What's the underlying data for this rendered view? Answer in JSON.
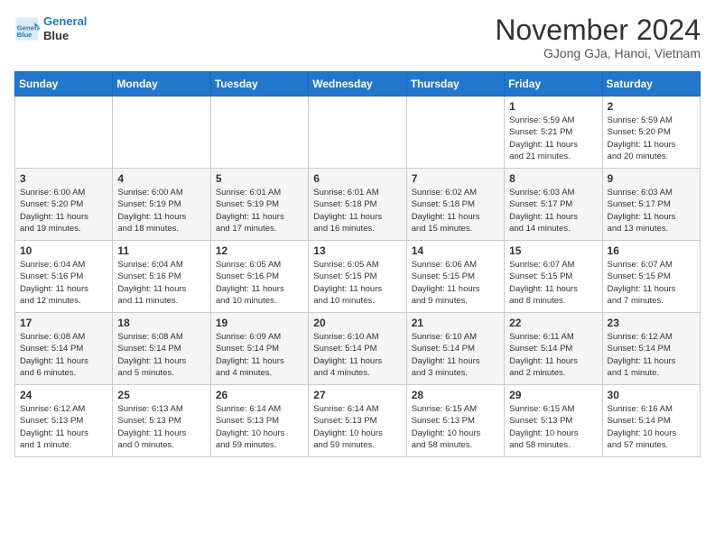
{
  "header": {
    "logo_line1": "General",
    "logo_line2": "Blue",
    "month": "November 2024",
    "location": "GJong GJa, Hanoi, Vietnam"
  },
  "days_of_week": [
    "Sunday",
    "Monday",
    "Tuesday",
    "Wednesday",
    "Thursday",
    "Friday",
    "Saturday"
  ],
  "weeks": [
    [
      {
        "day": "",
        "info": ""
      },
      {
        "day": "",
        "info": ""
      },
      {
        "day": "",
        "info": ""
      },
      {
        "day": "",
        "info": ""
      },
      {
        "day": "",
        "info": ""
      },
      {
        "day": "1",
        "info": "Sunrise: 5:59 AM\nSunset: 5:21 PM\nDaylight: 11 hours\nand 21 minutes."
      },
      {
        "day": "2",
        "info": "Sunrise: 5:59 AM\nSunset: 5:20 PM\nDaylight: 11 hours\nand 20 minutes."
      }
    ],
    [
      {
        "day": "3",
        "info": "Sunrise: 6:00 AM\nSunset: 5:20 PM\nDaylight: 11 hours\nand 19 minutes."
      },
      {
        "day": "4",
        "info": "Sunrise: 6:00 AM\nSunset: 5:19 PM\nDaylight: 11 hours\nand 18 minutes."
      },
      {
        "day": "5",
        "info": "Sunrise: 6:01 AM\nSunset: 5:19 PM\nDaylight: 11 hours\nand 17 minutes."
      },
      {
        "day": "6",
        "info": "Sunrise: 6:01 AM\nSunset: 5:18 PM\nDaylight: 11 hours\nand 16 minutes."
      },
      {
        "day": "7",
        "info": "Sunrise: 6:02 AM\nSunset: 5:18 PM\nDaylight: 11 hours\nand 15 minutes."
      },
      {
        "day": "8",
        "info": "Sunrise: 6:03 AM\nSunset: 5:17 PM\nDaylight: 11 hours\nand 14 minutes."
      },
      {
        "day": "9",
        "info": "Sunrise: 6:03 AM\nSunset: 5:17 PM\nDaylight: 11 hours\nand 13 minutes."
      }
    ],
    [
      {
        "day": "10",
        "info": "Sunrise: 6:04 AM\nSunset: 5:16 PM\nDaylight: 11 hours\nand 12 minutes."
      },
      {
        "day": "11",
        "info": "Sunrise: 6:04 AM\nSunset: 5:16 PM\nDaylight: 11 hours\nand 11 minutes."
      },
      {
        "day": "12",
        "info": "Sunrise: 6:05 AM\nSunset: 5:16 PM\nDaylight: 11 hours\nand 10 minutes."
      },
      {
        "day": "13",
        "info": "Sunrise: 6:05 AM\nSunset: 5:15 PM\nDaylight: 11 hours\nand 10 minutes."
      },
      {
        "day": "14",
        "info": "Sunrise: 6:06 AM\nSunset: 5:15 PM\nDaylight: 11 hours\nand 9 minutes."
      },
      {
        "day": "15",
        "info": "Sunrise: 6:07 AM\nSunset: 5:15 PM\nDaylight: 11 hours\nand 8 minutes."
      },
      {
        "day": "16",
        "info": "Sunrise: 6:07 AM\nSunset: 5:15 PM\nDaylight: 11 hours\nand 7 minutes."
      }
    ],
    [
      {
        "day": "17",
        "info": "Sunrise: 6:08 AM\nSunset: 5:14 PM\nDaylight: 11 hours\nand 6 minutes."
      },
      {
        "day": "18",
        "info": "Sunrise: 6:08 AM\nSunset: 5:14 PM\nDaylight: 11 hours\nand 5 minutes."
      },
      {
        "day": "19",
        "info": "Sunrise: 6:09 AM\nSunset: 5:14 PM\nDaylight: 11 hours\nand 4 minutes."
      },
      {
        "day": "20",
        "info": "Sunrise: 6:10 AM\nSunset: 5:14 PM\nDaylight: 11 hours\nand 4 minutes."
      },
      {
        "day": "21",
        "info": "Sunrise: 6:10 AM\nSunset: 5:14 PM\nDaylight: 11 hours\nand 3 minutes."
      },
      {
        "day": "22",
        "info": "Sunrise: 6:11 AM\nSunset: 5:14 PM\nDaylight: 11 hours\nand 2 minutes."
      },
      {
        "day": "23",
        "info": "Sunrise: 6:12 AM\nSunset: 5:14 PM\nDaylight: 11 hours\nand 1 minute."
      }
    ],
    [
      {
        "day": "24",
        "info": "Sunrise: 6:12 AM\nSunset: 5:13 PM\nDaylight: 11 hours\nand 1 minute."
      },
      {
        "day": "25",
        "info": "Sunrise: 6:13 AM\nSunset: 5:13 PM\nDaylight: 11 hours\nand 0 minutes."
      },
      {
        "day": "26",
        "info": "Sunrise: 6:14 AM\nSunset: 5:13 PM\nDaylight: 10 hours\nand 59 minutes."
      },
      {
        "day": "27",
        "info": "Sunrise: 6:14 AM\nSunset: 5:13 PM\nDaylight: 10 hours\nand 59 minutes."
      },
      {
        "day": "28",
        "info": "Sunrise: 6:15 AM\nSunset: 5:13 PM\nDaylight: 10 hours\nand 58 minutes."
      },
      {
        "day": "29",
        "info": "Sunrise: 6:15 AM\nSunset: 5:13 PM\nDaylight: 10 hours\nand 58 minutes."
      },
      {
        "day": "30",
        "info": "Sunrise: 6:16 AM\nSunset: 5:14 PM\nDaylight: 10 hours\nand 57 minutes."
      }
    ]
  ]
}
